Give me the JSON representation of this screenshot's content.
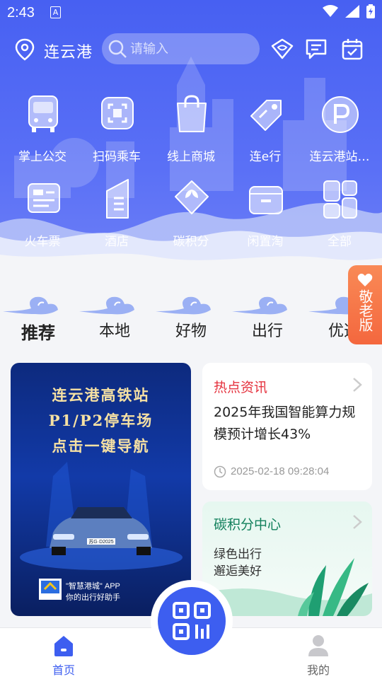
{
  "status_bar": {
    "time": "2:43",
    "sim_label": "A"
  },
  "top_bar": {
    "city": "连云港",
    "search_placeholder": "请输入"
  },
  "services": [
    {
      "label": "掌上公交",
      "icon": "bus-icon"
    },
    {
      "label": "扫码乘车",
      "icon": "scan-ride-icon"
    },
    {
      "label": "线上商城",
      "icon": "shopping-bag-icon"
    },
    {
      "label": "连e行",
      "icon": "tag-icon"
    },
    {
      "label": "连云港站…",
      "icon": "parking-icon"
    },
    {
      "label": "火车票",
      "icon": "train-ticket-icon"
    },
    {
      "label": "酒店",
      "icon": "hotel-icon"
    },
    {
      "label": "碳积分",
      "icon": "leaf-icon"
    },
    {
      "label": "闲置淘",
      "icon": "box-icon"
    },
    {
      "label": "全部",
      "icon": "all-apps-icon"
    }
  ],
  "tabs": [
    {
      "label": "推荐",
      "active": true
    },
    {
      "label": "本地",
      "active": false
    },
    {
      "label": "好物",
      "active": false
    },
    {
      "label": "出行",
      "active": false
    },
    {
      "label": "优选",
      "active": false
    }
  ],
  "elder_mode": {
    "label": "敬老版"
  },
  "banner": {
    "line1": "连云港高铁站",
    "line2": "P1/P2停车场",
    "line3": "点击一键导航",
    "plate": "苏G·D2025",
    "slogan1": "\"智慧港城\" APP",
    "slogan2": "你的出行好助手"
  },
  "news_card": {
    "heading": "热点资讯",
    "title": "2025年我国智能算力规模预计增长43%",
    "timestamp": "2025-02-18 09:28:04"
  },
  "carbon_card": {
    "heading": "碳积分中心",
    "line1": "绿色出行",
    "line2": "邂逅美好"
  },
  "bottom_nav": {
    "home": "首页",
    "mine": "我的"
  },
  "colors": {
    "primary": "#4760f2",
    "accent_red": "#e5323e",
    "elder_orange": "#f4673e",
    "green": "#12805c"
  }
}
